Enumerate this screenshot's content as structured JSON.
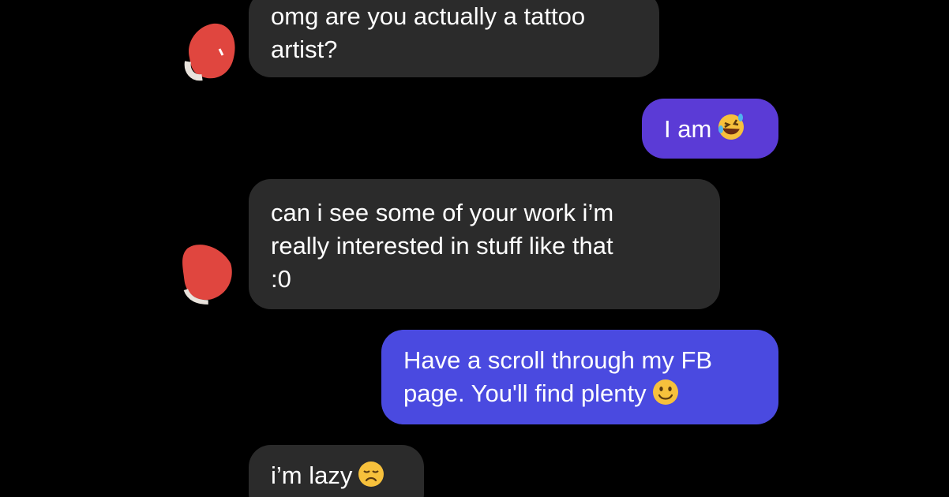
{
  "messages": [
    {
      "sender": "them",
      "text": "omg are you actually a tattoo\nartist?"
    },
    {
      "sender": "me",
      "text": "I am",
      "emoji": "rolling-on-floor-laughing-emoji"
    },
    {
      "sender": "them",
      "text": "can i see some of your work i’m\nreally interested in stuff like that\n:0"
    },
    {
      "sender": "me",
      "text": "Have a scroll through my FB\npage. You'll find plenty",
      "emoji": "slightly-smiling-face-emoji"
    },
    {
      "sender": "them",
      "text": "i’m lazy",
      "emoji": "disappointed-face-emoji"
    }
  ],
  "colors": {
    "background": "#000000",
    "received_bubble": "#2b2b2b",
    "sent_bubble_purple": "#5b3bd6",
    "sent_bubble_blue": "#4a4ae0",
    "avatar_redaction": "#e0463f"
  }
}
